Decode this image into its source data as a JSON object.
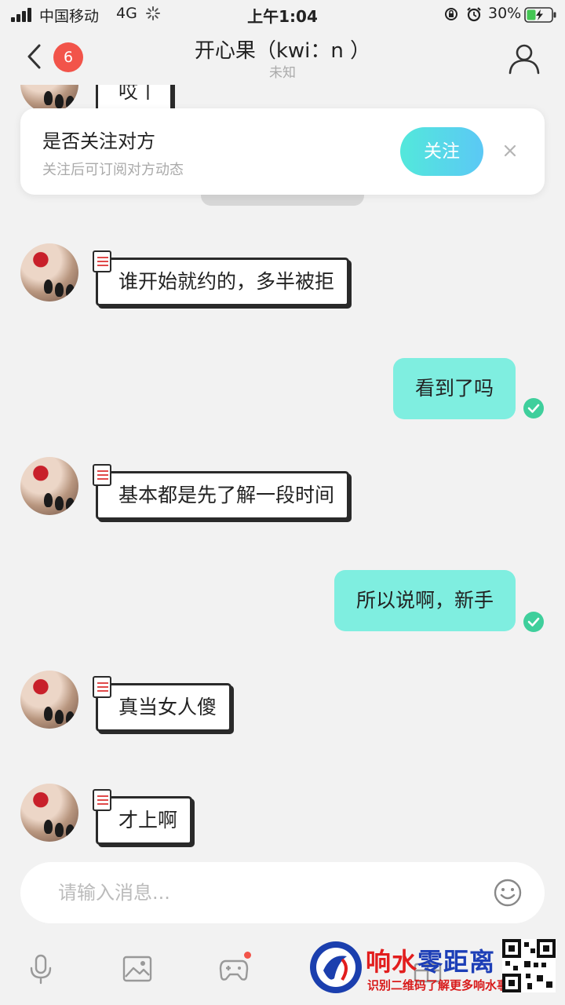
{
  "status_bar": {
    "carrier": "中国移动",
    "network": "4G",
    "time": "上午1:04",
    "battery": "30%"
  },
  "header": {
    "back_icon": "chevron-left-icon",
    "unread_count": "6",
    "title": "开心果（kwi：n ）",
    "subtitle": "未知",
    "profile_icon": "user-icon"
  },
  "follow_prompt": {
    "title": "是否关注对方",
    "subtitle": "关注后可订阅对方动态",
    "button": "关注",
    "close_icon": "close-icon"
  },
  "messages": [
    {
      "side": "in",
      "text": "哎丨"
    },
    {
      "side": "in",
      "text": "谁开始就约的，多半被拒"
    },
    {
      "side": "out",
      "text": "看到了吗",
      "status": "read"
    },
    {
      "side": "in",
      "text": "基本都是先了解一段时间"
    },
    {
      "side": "out",
      "text": "所以说啊，新手",
      "status": "read"
    },
    {
      "side": "in",
      "text": "真当女人傻"
    },
    {
      "side": "in",
      "text": "才上啊"
    }
  ],
  "input": {
    "placeholder": "请输入消息...",
    "emoji_icon": "smile-icon"
  },
  "toolbar": {
    "items": [
      "microphone-icon",
      "image-icon",
      "gamepad-icon",
      "gift-icon"
    ]
  },
  "watermark": {
    "title_part1": "响水",
    "title_part2": "零距离",
    "subtitle": "识别二维码了解更多响水事"
  },
  "colors": {
    "outgoing_bubble": "#7feee0",
    "badge": "#f2544a",
    "follow_button_start": "#53e8db",
    "follow_button_end": "#5bc8f5",
    "read_check": "#3fcf9c"
  }
}
